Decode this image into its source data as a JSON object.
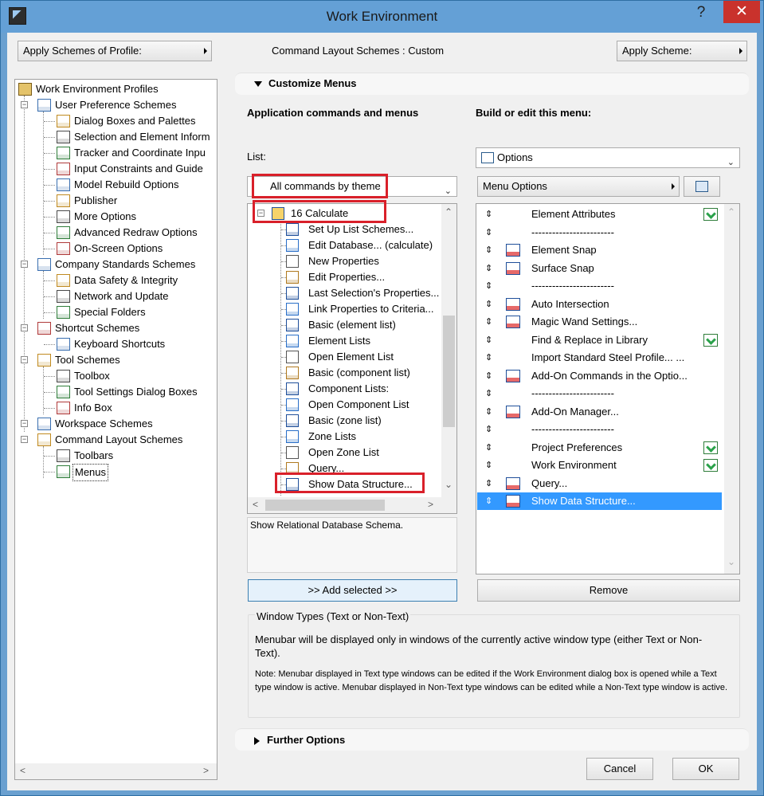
{
  "window": {
    "title": "Work Environment",
    "help": "?",
    "close": "✕"
  },
  "toolbar": {
    "apply_profile": "Apply Schemes of Profile:",
    "scheme_status": "Command Layout Schemes : Custom",
    "apply_scheme": "Apply Scheme:"
  },
  "tree": {
    "root": "Work Environment Profiles",
    "items": [
      {
        "label": "User Preference Schemes",
        "icon": "user-prefs-icon"
      },
      {
        "label": "Dialog Boxes and Palettes",
        "icon": "dialog-boxes-icon"
      },
      {
        "label": "Selection and Element Inform",
        "icon": "selection-info-icon"
      },
      {
        "label": "Tracker and Coordinate Inpu",
        "icon": "tracker-icon"
      },
      {
        "label": "Input Constraints and Guide",
        "icon": "input-constraints-icon"
      },
      {
        "label": "Model Rebuild Options",
        "icon": "model-rebuild-icon"
      },
      {
        "label": "Publisher",
        "icon": "publisher-icon"
      },
      {
        "label": "More Options",
        "icon": "more-options-icon"
      },
      {
        "label": "Advanced Redraw Options",
        "icon": "redraw-icon"
      },
      {
        "label": "On-Screen Options",
        "icon": "onscreen-icon"
      },
      {
        "label": "Company Standards Schemes",
        "icon": "company-standards-icon"
      },
      {
        "label": "Data Safety & Integrity",
        "icon": "data-safety-icon"
      },
      {
        "label": "Network and Update",
        "icon": "network-globe-icon"
      },
      {
        "label": "Special Folders",
        "icon": "folder-icon"
      },
      {
        "label": "Shortcut Schemes",
        "icon": "shortcut-schemes-icon"
      },
      {
        "label": "Keyboard Shortcuts",
        "icon": "keyboard-shortcut-icon"
      },
      {
        "label": "Tool Schemes",
        "icon": "tool-schemes-icon"
      },
      {
        "label": "Toolbox",
        "icon": "toolbox-icon"
      },
      {
        "label": "Tool Settings Dialog Boxes",
        "icon": "tool-settings-icon"
      },
      {
        "label": "Info Box",
        "icon": "info-box-icon"
      },
      {
        "label": "Workspace Schemes",
        "icon": "workspace-icon"
      },
      {
        "label": "Command Layout Schemes",
        "icon": "command-layout-icon"
      },
      {
        "label": "Toolbars",
        "icon": "toolbars-icon"
      },
      {
        "label": "Menus",
        "icon": "menus-icon"
      }
    ]
  },
  "customize": {
    "header": "Customize Menus",
    "left_title": "Application commands and menus",
    "right_title": "Build or edit this menu:",
    "list_label": "List:",
    "list_value": "All commands by theme",
    "menu_value": "Options",
    "menu_options_btn": "Menu Options",
    "commands_group": "16 Calculate",
    "commands": [
      {
        "label": "Set Up List Schemes...",
        "icon": "list-schemes-icon"
      },
      {
        "label": "Edit Database... (calculate)",
        "icon": "database-icon"
      },
      {
        "label": "New Properties",
        "icon": "new-doc-icon"
      },
      {
        "label": "Edit Properties...",
        "icon": "edit-properties-icon"
      },
      {
        "label": "Last Selection's Properties...",
        "icon": "last-selection-icon"
      },
      {
        "label": "Link Properties to Criteria...",
        "icon": "link-properties-icon"
      },
      {
        "label": "Basic (element list)",
        "icon": "basic-list-icon"
      },
      {
        "label": "Element Lists",
        "icon": "element-lists-icon"
      },
      {
        "label": "Open Element List",
        "icon": "open-list-icon"
      },
      {
        "label": "Basic (component list)",
        "icon": "basic-list-icon"
      },
      {
        "label": "Component Lists:",
        "icon": "component-lists-icon"
      },
      {
        "label": "Open Component List",
        "icon": "open-list-icon"
      },
      {
        "label": "Basic (zone list)",
        "icon": "basic-list-icon"
      },
      {
        "label": "Zone Lists",
        "icon": "zone-lists-icon"
      },
      {
        "label": "Open Zone List",
        "icon": "open-list-icon"
      },
      {
        "label": "Query...",
        "icon": "sql-icon"
      },
      {
        "label": "Show Data Structure...",
        "icon": "data-structure-icon"
      }
    ],
    "description": "Show Relational Database Schema.",
    "add_btn": ">> Add selected >>",
    "remove_btn": "Remove",
    "menu_items": [
      {
        "label": "Element Attributes",
        "icon": "",
        "green": true
      },
      {
        "label": "------------------------",
        "icon": "",
        "green": false
      },
      {
        "label": "Element Snap",
        "icon": "element-snap-icon",
        "green": false
      },
      {
        "label": "Surface Snap",
        "icon": "surface-snap-icon",
        "green": false
      },
      {
        "label": "------------------------",
        "icon": "",
        "green": false
      },
      {
        "label": "Auto Intersection",
        "icon": "auto-intersection-icon",
        "green": false
      },
      {
        "label": "Magic Wand Settings...",
        "icon": "magic-wand-icon",
        "green": false
      },
      {
        "label": "Find & Replace in Library",
        "icon": "",
        "green": true
      },
      {
        "label": "Import Standard Steel Profile... ...",
        "icon": "",
        "green": false
      },
      {
        "label": "Add-On Commands in the Optio...",
        "icon": "addon-commands-icon",
        "green": false
      },
      {
        "label": "------------------------",
        "icon": "",
        "green": false
      },
      {
        "label": "Add-On Manager...",
        "icon": "addon-manager-icon",
        "green": false
      },
      {
        "label": "------------------------",
        "icon": "",
        "green": false
      },
      {
        "label": "Project Preferences",
        "icon": "",
        "green": true
      },
      {
        "label": "Work Environment",
        "icon": "",
        "green": true
      },
      {
        "label": "Query...",
        "icon": "sql-icon",
        "green": false
      },
      {
        "label": "Show Data Structure...",
        "icon": "data-structure-icon",
        "green": false
      }
    ],
    "window_types_title": "Window Types (Text or Non-Text)",
    "window_types_text": "Menubar will be displayed only in windows of the currently active window type (either Text or Non-Text).",
    "window_types_note": "Note: Menubar displayed in Text type windows can be edited if the Work Environment dialog box is opened while a Text type window is active. Menubar displayed in Non-Text type windows can be edited while a Non-Text type window is active.",
    "further_options": "Further Options"
  },
  "footer": {
    "cancel": "Cancel",
    "ok": "OK"
  },
  "colors": {
    "accent_selection": "#3399ff",
    "highlight_box": "#d9202a",
    "title_bar": "#64a0d6"
  }
}
